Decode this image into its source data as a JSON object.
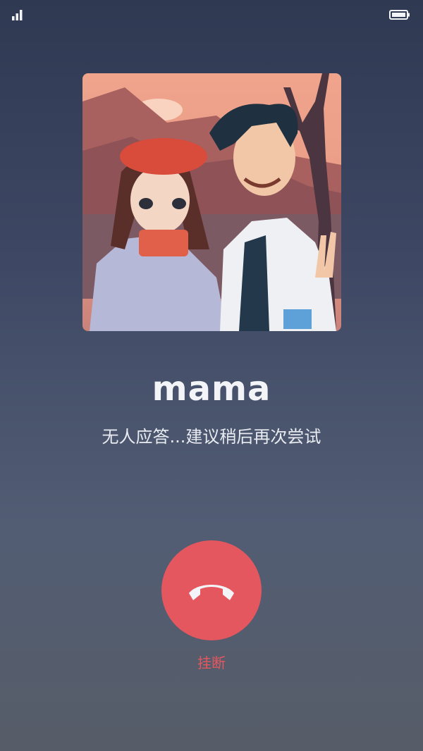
{
  "status_bar": {
    "signal_icon": "signal-bars-icon",
    "battery_icon": "battery-icon"
  },
  "contact": {
    "name": "mama",
    "photo_description_icon": "contact-photo"
  },
  "call": {
    "status_text": "无人应答...建议稍后再次尝试",
    "hangup_label": "挂断",
    "hangup_icon": "phone-hangup-icon"
  },
  "colors": {
    "background_top": "#2f3952",
    "background_bottom": "#575d68",
    "hangup_red": "#e5575f",
    "text_white": "#f2f4f7"
  }
}
